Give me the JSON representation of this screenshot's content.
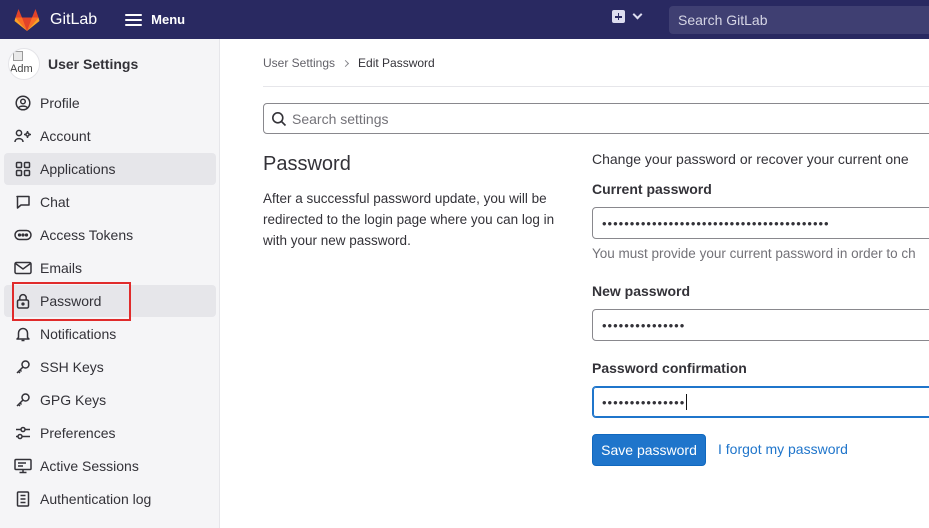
{
  "navbar": {
    "brand": "GitLab",
    "menu_label": "Menu",
    "search_placeholder": "Search GitLab"
  },
  "sidebar": {
    "title": "User Settings",
    "avatar_alt": "Adm",
    "items": [
      {
        "label": "Profile",
        "icon": "profile-icon"
      },
      {
        "label": "Account",
        "icon": "account-icon"
      },
      {
        "label": "Applications",
        "icon": "applications-icon"
      },
      {
        "label": "Chat",
        "icon": "chat-icon"
      },
      {
        "label": "Access Tokens",
        "icon": "token-icon"
      },
      {
        "label": "Emails",
        "icon": "mail-icon"
      },
      {
        "label": "Password",
        "icon": "lock-icon"
      },
      {
        "label": "Notifications",
        "icon": "bell-icon"
      },
      {
        "label": "SSH Keys",
        "icon": "key-icon"
      },
      {
        "label": "GPG Keys",
        "icon": "key-icon"
      },
      {
        "label": "Preferences",
        "icon": "preferences-icon"
      },
      {
        "label": "Active Sessions",
        "icon": "monitor-icon"
      },
      {
        "label": "Authentication log",
        "icon": "log-icon"
      }
    ]
  },
  "breadcrumb": {
    "parent": "User Settings",
    "current": "Edit Password"
  },
  "settings_search": {
    "placeholder": "Search settings"
  },
  "section": {
    "title": "Password",
    "description": "After a successful password update, you will be redirected to the login page where you can log in with your new password."
  },
  "form": {
    "intro": "Change your password or recover your current one",
    "current_password_label": "Current password",
    "current_password_value": "•••••••••••••••••••••••••••••••••••••••••",
    "current_password_help": "You must provide your current password in order to ch",
    "new_password_label": "New password",
    "new_password_value": "•••••••••••••••",
    "confirmation_label": "Password confirmation",
    "confirmation_value": "•••••••••••••••",
    "save_label": "Save password",
    "forgot_label": "I forgot my password"
  },
  "colors": {
    "navbar": "#292961",
    "primary": "#1f75cb",
    "highlight_box": "#e02b2b"
  }
}
